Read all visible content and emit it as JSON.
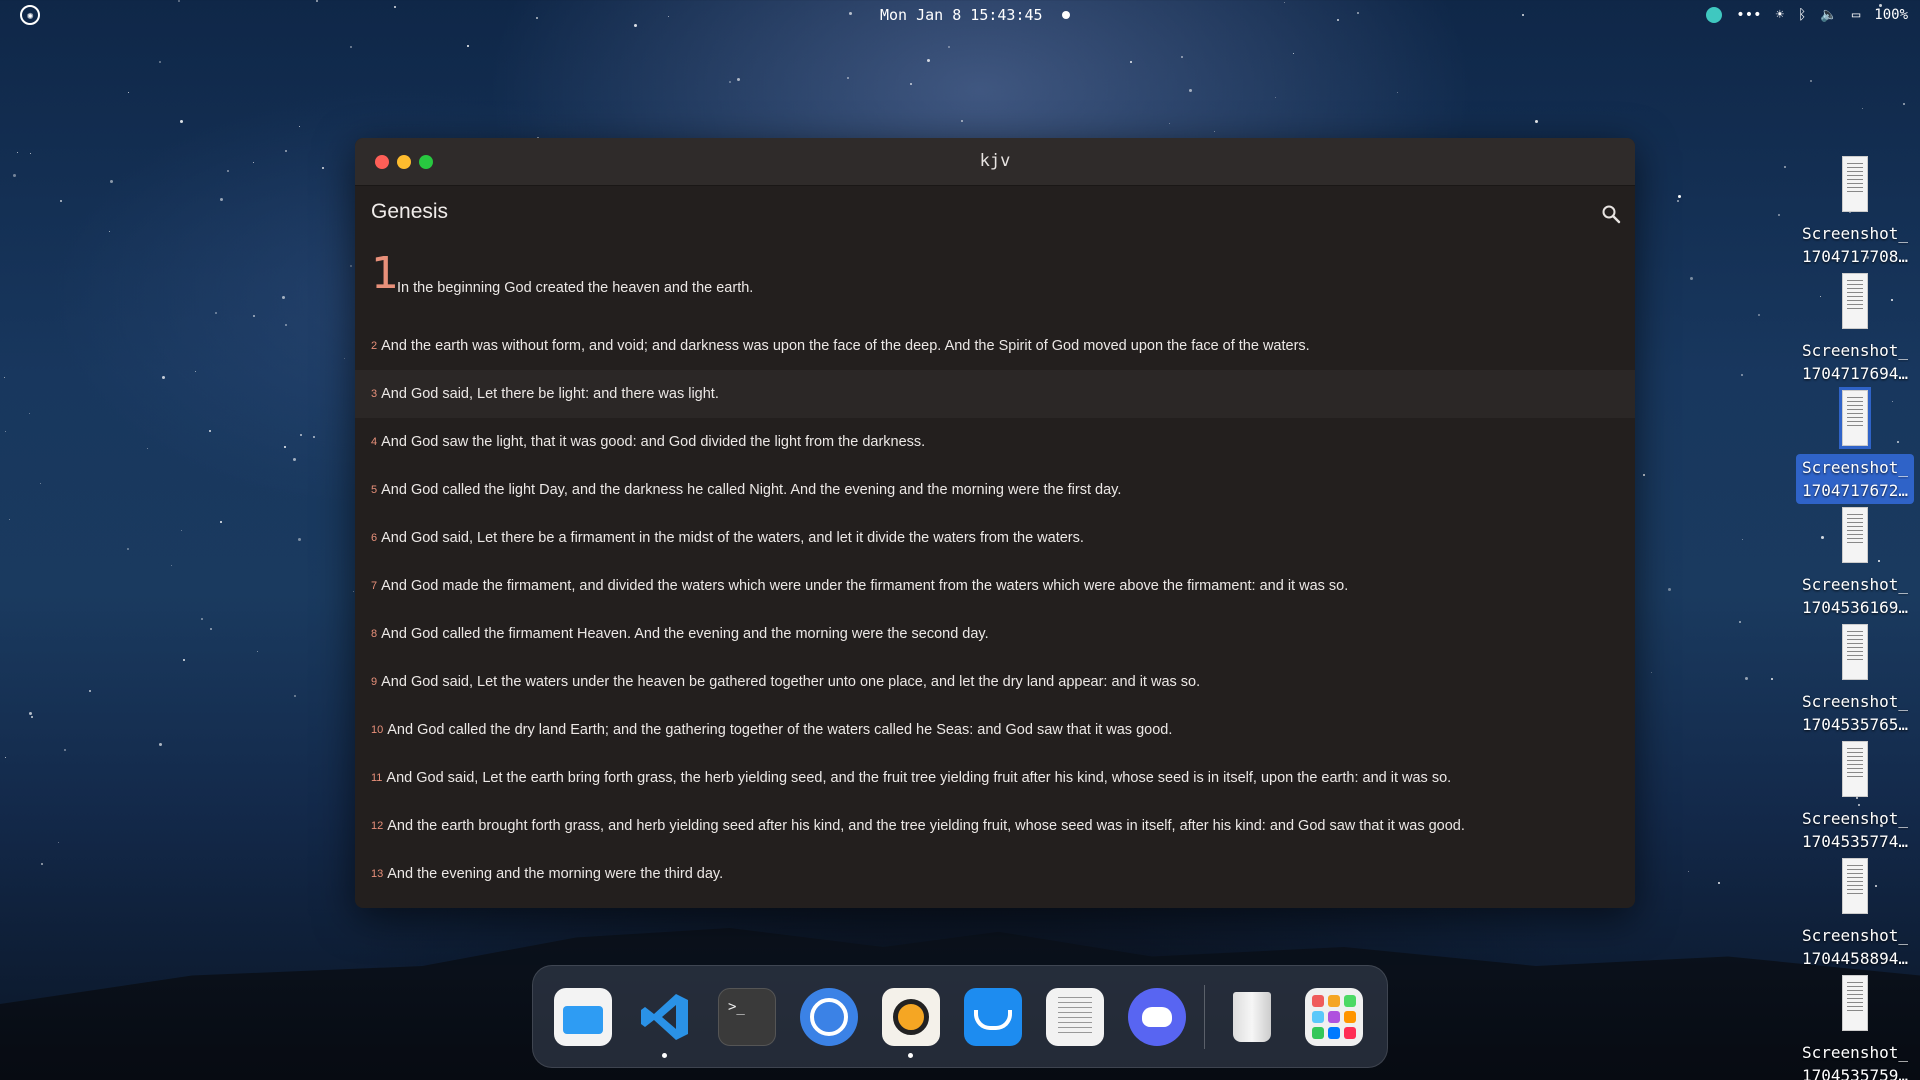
{
  "topbar": {
    "clock": "Mon Jan 8 15:43:45",
    "battery": "100%"
  },
  "window": {
    "title": "kjv",
    "book": "Genesis",
    "chapter": "1",
    "verses": [
      {
        "num": "1",
        "text": "In the beginning God created the heaven and the earth."
      },
      {
        "num": "2",
        "text": "And the earth was without form, and void; and darkness was upon the face of the deep. And the Spirit of God moved upon the face of the waters."
      },
      {
        "num": "3",
        "text": "And God said, Let there be light: and there was light."
      },
      {
        "num": "4",
        "text": "And God saw the light, that it was good: and God divided the light from the darkness."
      },
      {
        "num": "5",
        "text": "And God called the light Day, and the darkness he called Night. And the evening and the morning were the first day."
      },
      {
        "num": "6",
        "text": "And God said, Let there be a firmament in the midst of the waters, and let it divide the waters from the waters."
      },
      {
        "num": "7",
        "text": "And God made the firmament, and divided the waters which were under the firmament from the waters which were above the firmament: and it was so."
      },
      {
        "num": "8",
        "text": "And God called the firmament Heaven. And the evening and the morning were the second day."
      },
      {
        "num": "9",
        "text": "And God said, Let the waters under the heaven be gathered together unto one place, and let the dry land appear: and it was so."
      },
      {
        "num": "10",
        "text": "And God called the dry land Earth; and the gathering together of the waters called he Seas: and God saw that it was good."
      },
      {
        "num": "11",
        "text": "And God said, Let the earth bring forth grass, the herb yielding seed, and the fruit tree yielding fruit after his kind, whose seed is in itself, upon the earth: and it was so."
      },
      {
        "num": "12",
        "text": "And the earth brought forth grass, and herb yielding seed after his kind, and the tree yielding fruit, whose seed was in itself, after his kind: and God saw that it was good."
      },
      {
        "num": "13",
        "text": "And the evening and the morning were the third day."
      }
    ]
  },
  "desktop": {
    "files": [
      {
        "line1": "Screenshot_",
        "line2": "1704717708…"
      },
      {
        "line1": "Screenshot_",
        "line2": "1704717694…"
      },
      {
        "line1": "Screenshot_",
        "line2": "1704717672…"
      },
      {
        "line1": "Screenshot_",
        "line2": "1704536169…"
      },
      {
        "line1": "Screenshot_",
        "line2": "1704535765…"
      },
      {
        "line1": "Screenshot_",
        "line2": "1704535774…"
      },
      {
        "line1": "Screenshot_",
        "line2": "1704458894…"
      },
      {
        "line1": "Screenshot_",
        "line2": "1704535759…"
      }
    ]
  },
  "dock": {
    "terminal_glyph": ">_"
  },
  "colors": {
    "accent_verse_number": "#e8907a",
    "window_bg": "#231f1e",
    "selection": "#2f63c8"
  }
}
